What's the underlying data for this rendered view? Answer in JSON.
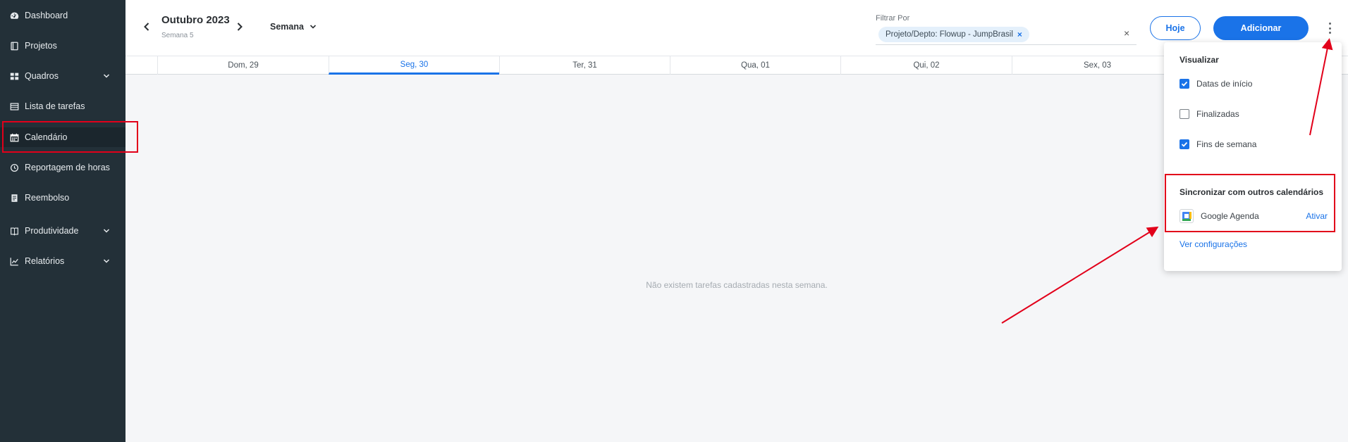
{
  "sidebar": {
    "items": [
      {
        "label": "Dashboard",
        "icon": "speedometer-icon"
      },
      {
        "label": "Projetos",
        "icon": "book-icon"
      },
      {
        "label": "Quadros",
        "icon": "grid-icon",
        "expandable": true
      },
      {
        "label": "Lista de tarefas",
        "icon": "table-icon"
      },
      {
        "label": "Calendário",
        "icon": "calendar-icon",
        "active": true
      },
      {
        "label": "Reportagem de horas",
        "icon": "clock-icon"
      },
      {
        "label": "Reembolso",
        "icon": "receipt-icon"
      },
      {
        "label": "Produtividade",
        "icon": "book-open-icon",
        "expandable": true
      },
      {
        "label": "Relatórios",
        "icon": "chart-line-icon",
        "expandable": true
      }
    ]
  },
  "header": {
    "month": "Outubro 2023",
    "week": "Semana 5",
    "view": "Semana",
    "filter_label": "Filtrar Por",
    "filter_chip": "Projeto/Depto: Flowup - JumpBrasil",
    "filter_clear": "×",
    "chip_remove": "×",
    "today_button": "Hoje",
    "add_button": "Adicionar"
  },
  "days": [
    {
      "label": "Dom, 29"
    },
    {
      "label": "Seg, 30",
      "selected": true
    },
    {
      "label": "Ter, 31"
    },
    {
      "label": "Qua, 01"
    },
    {
      "label": "Qui, 02"
    },
    {
      "label": "Sex, 03"
    }
  ],
  "empty_message": "Não existem tarefas cadastradas nesta semana.",
  "menu": {
    "title": "Visualizar",
    "options": [
      {
        "label": "Datas de início",
        "checked": true
      },
      {
        "label": "Finalizadas",
        "checked": false
      },
      {
        "label": "Fins de semana",
        "checked": true
      }
    ],
    "sync_title": "Sincronizar com outros calendários",
    "google_label": "Google Agenda",
    "activate": "Ativar",
    "settings_link": "Ver configurações"
  },
  "colors": {
    "sidebar_bg": "#233038",
    "accent": "#1a73e8",
    "annotation": "#e2001a"
  }
}
